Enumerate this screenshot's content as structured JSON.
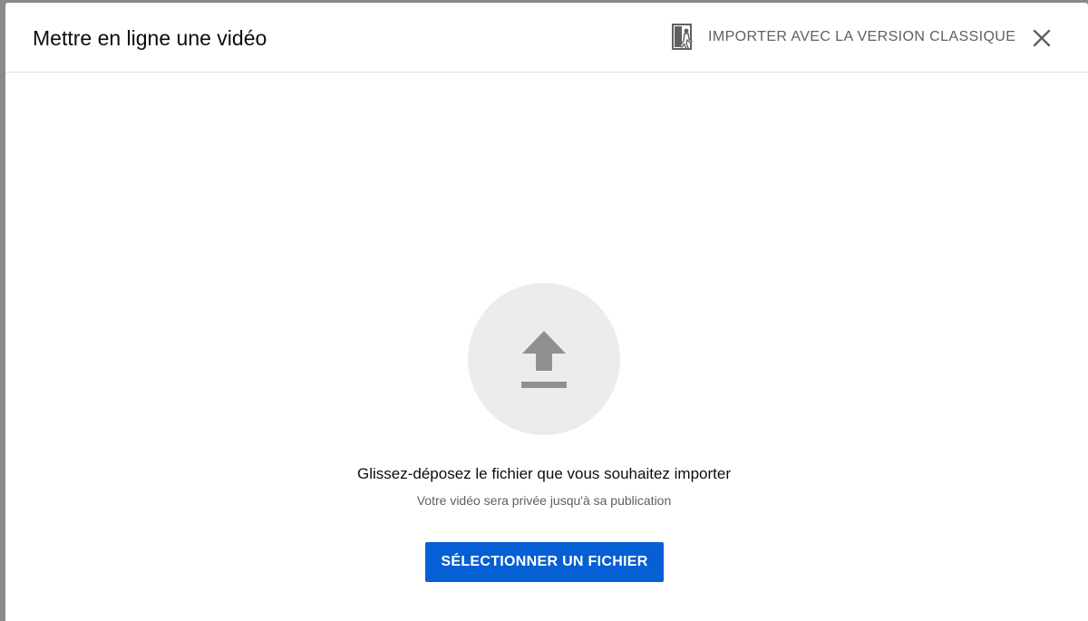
{
  "dialog": {
    "title": "Mettre en ligne une vidéo",
    "classic_label": "IMPORTER AVEC LA VERSION CLASSIQUE",
    "classic_icon": "exit-classic-icon",
    "close_icon": "close-icon"
  },
  "upload": {
    "icon": "upload-arrow-icon",
    "drop_text": "Glissez-déposez le fichier que vous souhaitez importer",
    "sub_text": "Votre vidéo sera privée jusqu'à sa publication",
    "select_label": "SÉLECTIONNER UN FICHIER"
  },
  "colors": {
    "accent": "#065fd4",
    "icon_gray": "#909090",
    "circle_bg": "#ececec"
  }
}
